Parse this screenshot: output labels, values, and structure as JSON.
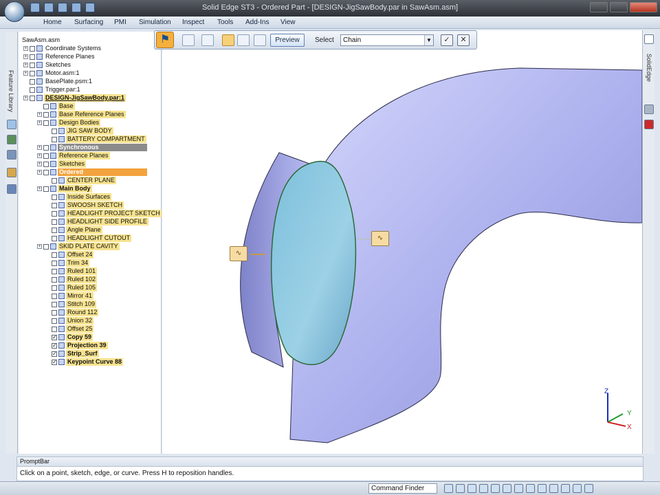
{
  "window": {
    "title": "Solid Edge ST3 - Ordered Part - [DESIGN-JigSawBody.par in SawAsm.asm]"
  },
  "menu": [
    "Home",
    "Surfacing",
    "PMI",
    "Simulation",
    "Inspect",
    "Tools",
    "Add-Ins",
    "View"
  ],
  "left_rail": {
    "label": "Feature Library"
  },
  "right_rail": {
    "label": "SolidEdge"
  },
  "tree": {
    "root": "SawAsm.asm",
    "items": [
      {
        "label": "Coordinate Systems",
        "state": "normal"
      },
      {
        "label": "Reference Planes",
        "state": "normal"
      },
      {
        "label": "Sketches",
        "state": "normal"
      },
      {
        "label": "Motor.asm:1",
        "state": "normal"
      },
      {
        "label": "BasePlate.psm:1",
        "state": "normal"
      },
      {
        "label": "Trigger.par:1",
        "state": "normal"
      },
      {
        "label": "DESIGN-JigSawBody.par:1",
        "state": "active"
      },
      {
        "label": "Base",
        "state": "highlight"
      },
      {
        "label": "Base Reference Planes",
        "state": "highlight"
      },
      {
        "label": "Design Bodies",
        "state": "highlight"
      },
      {
        "label": "JIG SAW BODY",
        "state": "highlight"
      },
      {
        "label": "BATTERY COMPARTMENT",
        "state": "highlight"
      },
      {
        "label": "Synchronous",
        "state": "group"
      },
      {
        "label": "Reference Planes",
        "state": "highlight"
      },
      {
        "label": "Sketches",
        "state": "highlight"
      },
      {
        "label": "Ordered",
        "state": "ordered"
      },
      {
        "label": "CENTER PLANE",
        "state": "highlight"
      },
      {
        "label": "Main Body",
        "state": "bold"
      },
      {
        "label": "Inside Surfaces",
        "state": "highlight"
      },
      {
        "label": "SWOOSH SKETCH",
        "state": "highlight"
      },
      {
        "label": "HEADLIGHT PROJECT SKETCH",
        "state": "highlight"
      },
      {
        "label": "HEADLIGHT SIDE PROFILE",
        "state": "highlight"
      },
      {
        "label": "Angle Plane",
        "state": "highlight"
      },
      {
        "label": "HEADLIGHT CUTOUT",
        "state": "highlight"
      },
      {
        "label": "SKID PLATE CAVITY",
        "state": "highlight"
      },
      {
        "label": "Offset 24",
        "state": "highlight"
      },
      {
        "label": "Trim 34",
        "state": "highlight"
      },
      {
        "label": "Ruled 101",
        "state": "highlight"
      },
      {
        "label": "Ruled 102",
        "state": "highlight"
      },
      {
        "label": "Ruled 105",
        "state": "highlight"
      },
      {
        "label": "Mirror 41",
        "state": "highlight"
      },
      {
        "label": "Stitch 109",
        "state": "highlight"
      },
      {
        "label": "Round 112",
        "state": "highlight"
      },
      {
        "label": "Union 32",
        "state": "highlight"
      },
      {
        "label": "Offset 25",
        "state": "highlight"
      },
      {
        "label": "Copy 59",
        "state": "checked"
      },
      {
        "label": "Projection 39",
        "state": "checked"
      },
      {
        "label": "Strip_Surf",
        "state": "checked"
      },
      {
        "label": "Keypoint Curve 88",
        "state": "checked"
      }
    ]
  },
  "command_bar": {
    "preview_label": "Preview",
    "select_label": "Select",
    "select_value": "Chain",
    "ok_glyph": "✓",
    "cancel_glyph": "✕"
  },
  "axes": {
    "x": "X",
    "y": "Y",
    "z": "Z"
  },
  "prompt": {
    "title": "PromptBar",
    "text": "Click on a point, sketch, edge, or curve. Press H to reposition handles."
  },
  "status": {
    "command_finder": "Command Finder"
  },
  "colors": {
    "model_surface": "#aeb2ee",
    "selected_face": "#8cc3de",
    "ordered_group": "#f3a33d",
    "highlight": "#f7e38f"
  }
}
